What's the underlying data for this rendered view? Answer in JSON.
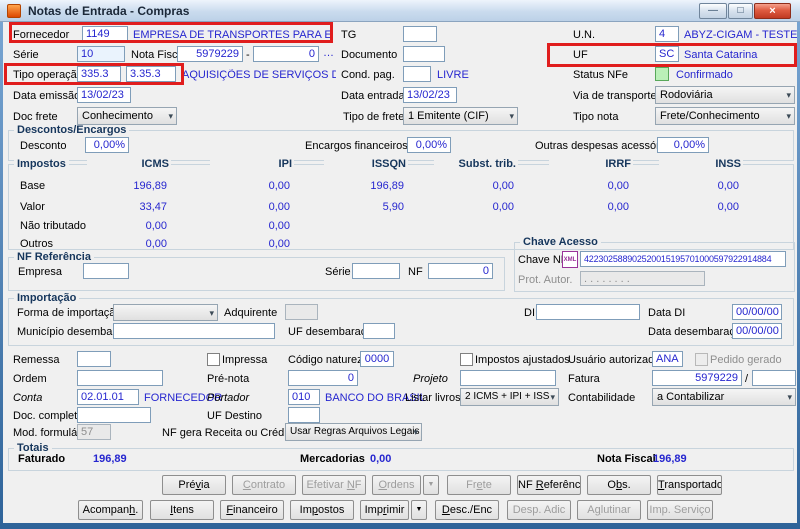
{
  "window": {
    "title": "Notas de Entrada - Compras",
    "controls": {
      "minimize": "—",
      "maximize": "□",
      "close": "×"
    }
  },
  "icons": {
    "chevron": "▾",
    "split_arrow": "▼"
  },
  "header": {
    "fornecedor": {
      "label": "Fornecedor",
      "code": "1149",
      "name": "EMPRESA DE TRANSPORTES PARA EXTERIOR LTD"
    },
    "tg": {
      "label": "TG",
      "value": ""
    },
    "un": {
      "label": "U.N.",
      "code": "4",
      "name": "ABYZ-CIGAM - TESTE"
    },
    "serie": {
      "label": "Série",
      "value": "10"
    },
    "nota_fiscal": {
      "label": "Nota Fiscal",
      "value": "5979229",
      "sep": "-",
      "value2": "0",
      "more": "…"
    },
    "documento": {
      "label": "Documento",
      "value": ""
    },
    "uf": {
      "label": "UF",
      "code": "SC",
      "name": "Santa Catarina"
    },
    "tipo_operacao": {
      "label": "Tipo operação",
      "code1": "335.3",
      "code2": "3.35.3",
      "desc": "AQUISIÇÕES DE SERVIÇOS DE TRAN"
    },
    "cond_pag": {
      "label": "Cond. pag.",
      "value": "",
      "status": "LIVRE"
    },
    "status_nfe": {
      "label": "Status NFe",
      "value": "Confirmado"
    },
    "data_emissao": {
      "label": "Data emissão",
      "value": "13/02/23"
    },
    "data_entrada": {
      "label": "Data entrada",
      "value": "13/02/23"
    },
    "via_transporte": {
      "label": "Via de transporte",
      "value": "Rodoviária"
    },
    "doc_frete": {
      "label": "Doc frete",
      "value": "Conhecimento"
    },
    "tipo_frete": {
      "label": "Tipo de frete",
      "value": "1 Emitente (CIF)"
    },
    "tipo_nota": {
      "label": "Tipo nota",
      "value": "Frete/Conhecimento"
    }
  },
  "descontos": {
    "title": "Descontos/Encargos",
    "desconto_label": "Desconto",
    "desconto": "0,00%",
    "encargos_label": "Encargos financeiros",
    "encargos": "0,00%",
    "outras_label": "Outras despesas acessórias",
    "outras": "0,00%"
  },
  "impostos": {
    "title": "Impostos",
    "columns": [
      "ICMS",
      "IPI",
      "ISSQN",
      "Subst. trib.",
      "IRRF",
      "INSS"
    ],
    "rows": [
      {
        "label": "Base",
        "v": [
          "196,89",
          "0,00",
          "196,89",
          "0,00",
          "0,00",
          "0,00"
        ]
      },
      {
        "label": "Valor",
        "v": [
          "33,47",
          "0,00",
          "5,90",
          "0,00",
          "0,00",
          "0,00"
        ]
      },
      {
        "label": "Não tributado",
        "v": [
          "0,00",
          "0,00",
          "",
          "",
          "",
          ""
        ]
      },
      {
        "label": "Outros",
        "v": [
          "0,00",
          "0,00",
          "",
          "",
          "",
          ""
        ]
      }
    ]
  },
  "nf_referencia": {
    "title": "NF Referência",
    "empresa_label": "Empresa",
    "empresa": "",
    "serie_label": "Série",
    "serie": "",
    "nf_label": "NF",
    "nf": "0"
  },
  "chave_acesso": {
    "title": "Chave Acesso",
    "chave_label": "Chave NFe",
    "xml_icon": "XML",
    "chave": "422302588902520015195701000597922914884",
    "prot_label": "Prot. Autor.",
    "prot": ".   .   .   .   .   .   .   ."
  },
  "importacao": {
    "title": "Importação",
    "forma_label": "Forma de importação",
    "forma": "",
    "adquirente_label": "Adquirente",
    "adquirente": "",
    "di_label": "DI",
    "di": "",
    "data_di_label": "Data DI",
    "data_di": "00/00/00",
    "municipio_label": "Município desembaraço",
    "municipio": "",
    "uf_desembaraco_label": "UF desembaraço",
    "uf_desembaraco": "",
    "data_desembaraco_label": "Data desembaraço",
    "data_desembaraco": "00/00/00"
  },
  "detalhes": {
    "remessa_label": "Remessa",
    "remessa": "",
    "impressa_label": "Impressa",
    "codigo_natureza_label": "Código natureza",
    "codigo_natureza": "0000",
    "impostos_ajustados_label": "Impostos ajustados",
    "usuario_label": "Usuário autorizado",
    "usuario": "ANA",
    "pedido_gerado_label": "Pedido gerado",
    "ordem_label": "Ordem",
    "ordem": "",
    "pre_nota_label": "Pré-nota",
    "pre_nota": "0",
    "projeto_label": "Projeto",
    "projeto": "",
    "fatura_label": "Fatura",
    "fatura": "5979229",
    "fatura_sep": "/",
    "fatura2": "",
    "conta_label": "Conta",
    "conta": "02.01.01",
    "conta_desc": "FORNECEDOR",
    "portador_label": "Portador",
    "portador": "010",
    "portador_desc": "BANCO DO BRASIL",
    "listar_label": "Listar livros",
    "listar": "2 ICMS + IPI + ISS",
    "contab_label": "Contabilidade",
    "contab": "a Contabilizar",
    "doc_completo_label": "Doc. completo",
    "doc_completo": "",
    "uf_destino_label": "UF Destino",
    "uf_destino": "",
    "mod_label": "Mod. formulário",
    "mod": "57",
    "nf_gera_label": "NF gera Receita ou Crédito",
    "nf_gera": "Usar Regras Arquivos Legais"
  },
  "totais": {
    "title": "Totais",
    "faturado_label": "Faturado",
    "faturado": "196,89",
    "mercadorias_label": "Mercadorias",
    "mercadorias": "0,00",
    "nota_fiscal_label": "Nota Fiscal",
    "nota_fiscal": "196,89"
  },
  "buttons": {
    "row1": [
      {
        "label": "Prévia",
        "enabled": true
      },
      {
        "label": "Contrato",
        "enabled": false
      },
      {
        "label": "Efetivar NF",
        "enabled": false
      },
      {
        "label": "Ordens",
        "enabled": false
      },
      {
        "label": "Frete",
        "enabled": false
      },
      {
        "label": "NF Referência",
        "enabled": true
      },
      {
        "label": "Obs.",
        "enabled": true
      },
      {
        "label": "Transportadora",
        "enabled": true
      }
    ],
    "row2": [
      {
        "label": "Acompanh.",
        "enabled": true
      },
      {
        "label": "Itens",
        "enabled": true
      },
      {
        "label": "Financeiro",
        "enabled": true
      },
      {
        "label": "Impostos",
        "enabled": true
      },
      {
        "label": "Imprimir",
        "enabled": true
      },
      {
        "label": "Desc./Enc",
        "enabled": true
      },
      {
        "label": "Desp. Adic",
        "enabled": false
      },
      {
        "label": "Aglutinar",
        "enabled": false
      },
      {
        "label": "Imp. Serviço",
        "enabled": false
      }
    ]
  }
}
